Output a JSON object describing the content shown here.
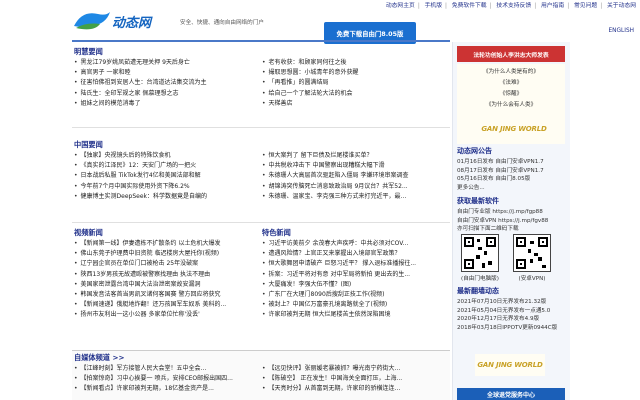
{
  "top_nav": [
    "动态网主页",
    "手机版",
    "免费软件下载",
    "技术支持反馈",
    "用户指南",
    "常见问题",
    "关于动态网"
  ],
  "header": {
    "logo_text": "动态网",
    "slogan": "安全、快捷、通向自由网络的门户",
    "download_button": "免费下载自由门8.05版",
    "english_link": "ENGLISH"
  },
  "sections": {
    "mh": {
      "title": "明慧要闻",
      "left": [
        "黑龙江79岁姚凤茹遭无理关押 9天后身亡",
        "高官男子 一家和睦",
        "征害怕佛祖到安居人生：台湾道达法集交流为主",
        "陆氏生：全印军规之家 佩慕理想之志",
        "姐妹之间的模范消毒了"
      ],
      "right": [
        "老有收获：和顾家同何往之後",
        "撮取思想圆：小城青年的意外获醒",
        "「再看推」的圆满结局",
        "给自己一个了解法轮大法的机会",
        "天梯善店"
      ]
    },
    "china": {
      "title": "中国要闻",
      "left": [
        "【独家】央视镜头后的特殊饮食机",
        "《真实的江泽民》12：天安门广场的一把火",
        "日本战后私服 TikTok发行4亿和美国法部和解",
        "今年前7个月中国实际使用外资下降6.2%",
        "健康博主实测DeepSeek：科学数据竟是自编的"
      ],
      "right": [
        "恒大案判了 留下巨债及烂尾楼谁买单？",
        "中共税收冲击下 中国警察出现糟糕大幅下滑",
        "朱德珊人大高层首次驱赶陷入僵局 李嫌环境审案调查",
        "胡锦涛突传脑死亡消息致政治局 9月议台？共军52...",
        "朱德珊、温家宝、李克强三种方式来打完近平，最..."
      ]
    },
    "video": {
      "title": "视频新闻",
      "left": [
        "【新闻第一线】伊妻遭栋不扩散条约 以土危机大爆发",
        "佛山东莞子护理费中旧资院 临迟楼房大屋托你(视频)",
        "辽宁园企官员在单位门口被枪击 25年没破案",
        "陕西13岁男孩无故遭殴被警察找理由 执法不理由",
        "美国家密泄露台湾中国大法治泄密案故安漏洞",
        "韩国发音法客首当男凯叉诸何客国赛 警方回应将获究",
        "【新闻速递】俄艇地炸翻！还万孩国军车奴系 美科的...",
        "扬州市友利出一这小公器 多家单位忙称'没丢'"
      ],
      "title2": "特色新闻",
      "right": [
        "习近平访美前夕 余茂春大声疾呼：中共必须对COV...",
        "遭遇风险情？上官正又来掌握出入境部官军政策？",
        "恒大歌舞团申请破产 巨怒习近平？ 撑入退标准播报往...",
        "拆案：习近平将对有意 对中军局将新拍 更出去的生...",
        "大厦痛发！李强大伍不懂？(图)",
        "广东厂在大理门8090后搜刮正技工作(视频)",
        "被封上？中国亿万富豪孔境离路就全了(视频)",
        "许家印被判无期 恒大烂尾楼苦主依然深陷困境"
      ]
    },
    "free_channel": {
      "title": "自媒体频道 >>",
      "left": [
        "【江峰时刻】军方接管人民大会堂！五中全会...",
        "【拍案惊奇】习中心挨要一 喷兵，安排CEO邮报出国四...",
        "【新闻看点】许家印被判无期，18亿基金资产是..."
      ],
      "right": [
        "【远见快评】张丽媛老暴被抓？曝光南宁药街大...",
        "【陈破空】 正在发生！中国海关全面打压，上海...",
        "【天亮时分】从首富到无期，许家印的骄横连连..."
      ]
    }
  },
  "sidebar": {
    "banner": "法轮功创始人李洪志大师发表",
    "books": [
      "《为什么人类是有的》",
      "《法难》",
      "《惊醒》",
      "《为什么会有人类》"
    ],
    "gw_logo_text": "GAN JING WORLD",
    "announcement_title": "动态网公告",
    "announcements": [
      "01月16日发布 自由门安卓VPN1.7",
      "08月17日发布 自由门安卓VPN1.7",
      "05月16日发布 自由门8.05版",
      "更多公告..."
    ],
    "software_title": "获取最新软件",
    "software": [
      "自由门专业版 https://j.mp/fgp88",
      "自由门安卓VPN https://j.mp/fgv88",
      "亦可扫描下面二维码下载"
    ],
    "qr_labels": [
      "(自由门电脑版)",
      "(安卓VPN)"
    ],
    "update_title": "最新翻墙动态",
    "updates": [
      "2021年07月10日无界发布21.32版",
      "2021年05月04日无界发布一点通5.0",
      "2020年12月17日无界发布4.9版",
      "2018年03月18日IPPOTV更新0944C版"
    ],
    "bottom_banner": "全球退党服务中心"
  },
  "colors": {
    "accent": "#1f2f8a",
    "download_bg": "#1a6fd0",
    "banner_red": "#cc3333",
    "gold": "#c9a227"
  }
}
